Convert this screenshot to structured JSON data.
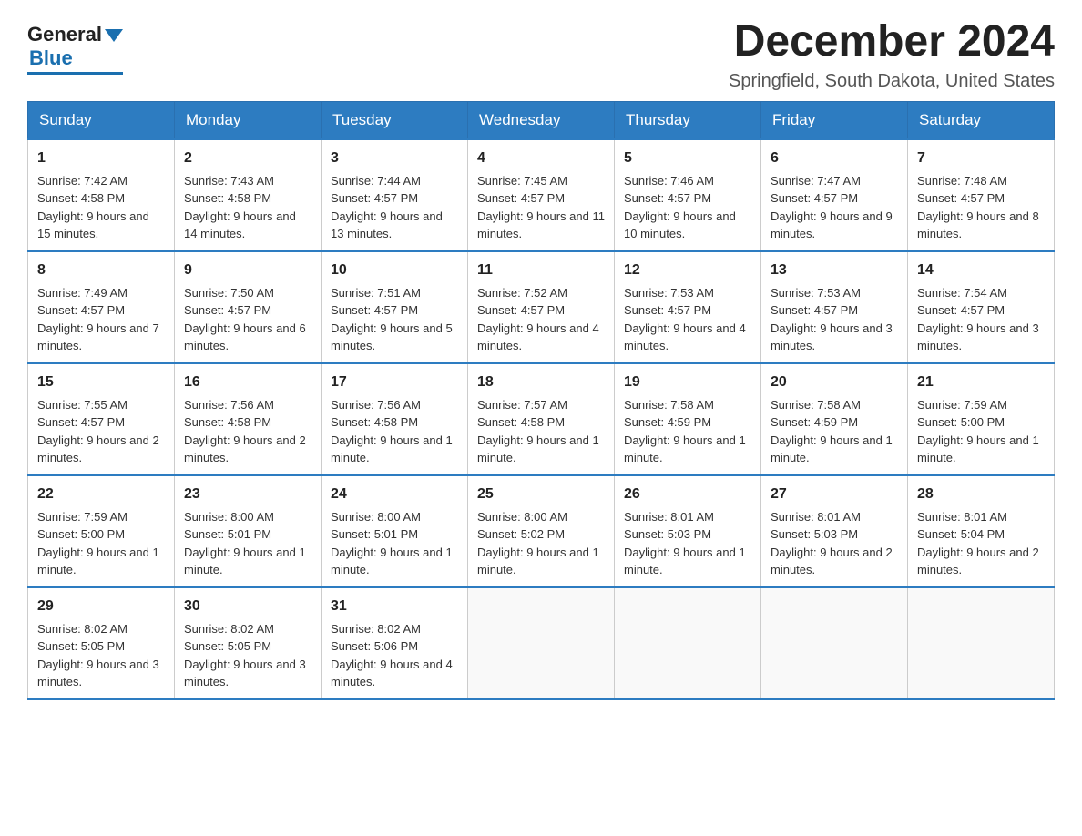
{
  "logo": {
    "general": "General",
    "blue": "Blue"
  },
  "title": "December 2024",
  "location": "Springfield, South Dakota, United States",
  "weekdays": [
    "Sunday",
    "Monday",
    "Tuesday",
    "Wednesday",
    "Thursday",
    "Friday",
    "Saturday"
  ],
  "weeks": [
    [
      {
        "day": "1",
        "sunrise": "7:42 AM",
        "sunset": "4:58 PM",
        "daylight": "9 hours and 15 minutes."
      },
      {
        "day": "2",
        "sunrise": "7:43 AM",
        "sunset": "4:58 PM",
        "daylight": "9 hours and 14 minutes."
      },
      {
        "day": "3",
        "sunrise": "7:44 AM",
        "sunset": "4:57 PM",
        "daylight": "9 hours and 13 minutes."
      },
      {
        "day": "4",
        "sunrise": "7:45 AM",
        "sunset": "4:57 PM",
        "daylight": "9 hours and 11 minutes."
      },
      {
        "day": "5",
        "sunrise": "7:46 AM",
        "sunset": "4:57 PM",
        "daylight": "9 hours and 10 minutes."
      },
      {
        "day": "6",
        "sunrise": "7:47 AM",
        "sunset": "4:57 PM",
        "daylight": "9 hours and 9 minutes."
      },
      {
        "day": "7",
        "sunrise": "7:48 AM",
        "sunset": "4:57 PM",
        "daylight": "9 hours and 8 minutes."
      }
    ],
    [
      {
        "day": "8",
        "sunrise": "7:49 AM",
        "sunset": "4:57 PM",
        "daylight": "9 hours and 7 minutes."
      },
      {
        "day": "9",
        "sunrise": "7:50 AM",
        "sunset": "4:57 PM",
        "daylight": "9 hours and 6 minutes."
      },
      {
        "day": "10",
        "sunrise": "7:51 AM",
        "sunset": "4:57 PM",
        "daylight": "9 hours and 5 minutes."
      },
      {
        "day": "11",
        "sunrise": "7:52 AM",
        "sunset": "4:57 PM",
        "daylight": "9 hours and 4 minutes."
      },
      {
        "day": "12",
        "sunrise": "7:53 AM",
        "sunset": "4:57 PM",
        "daylight": "9 hours and 4 minutes."
      },
      {
        "day": "13",
        "sunrise": "7:53 AM",
        "sunset": "4:57 PM",
        "daylight": "9 hours and 3 minutes."
      },
      {
        "day": "14",
        "sunrise": "7:54 AM",
        "sunset": "4:57 PM",
        "daylight": "9 hours and 3 minutes."
      }
    ],
    [
      {
        "day": "15",
        "sunrise": "7:55 AM",
        "sunset": "4:57 PM",
        "daylight": "9 hours and 2 minutes."
      },
      {
        "day": "16",
        "sunrise": "7:56 AM",
        "sunset": "4:58 PM",
        "daylight": "9 hours and 2 minutes."
      },
      {
        "day": "17",
        "sunrise": "7:56 AM",
        "sunset": "4:58 PM",
        "daylight": "9 hours and 1 minute."
      },
      {
        "day": "18",
        "sunrise": "7:57 AM",
        "sunset": "4:58 PM",
        "daylight": "9 hours and 1 minute."
      },
      {
        "day": "19",
        "sunrise": "7:58 AM",
        "sunset": "4:59 PM",
        "daylight": "9 hours and 1 minute."
      },
      {
        "day": "20",
        "sunrise": "7:58 AM",
        "sunset": "4:59 PM",
        "daylight": "9 hours and 1 minute."
      },
      {
        "day": "21",
        "sunrise": "7:59 AM",
        "sunset": "5:00 PM",
        "daylight": "9 hours and 1 minute."
      }
    ],
    [
      {
        "day": "22",
        "sunrise": "7:59 AM",
        "sunset": "5:00 PM",
        "daylight": "9 hours and 1 minute."
      },
      {
        "day": "23",
        "sunrise": "8:00 AM",
        "sunset": "5:01 PM",
        "daylight": "9 hours and 1 minute."
      },
      {
        "day": "24",
        "sunrise": "8:00 AM",
        "sunset": "5:01 PM",
        "daylight": "9 hours and 1 minute."
      },
      {
        "day": "25",
        "sunrise": "8:00 AM",
        "sunset": "5:02 PM",
        "daylight": "9 hours and 1 minute."
      },
      {
        "day": "26",
        "sunrise": "8:01 AM",
        "sunset": "5:03 PM",
        "daylight": "9 hours and 1 minute."
      },
      {
        "day": "27",
        "sunrise": "8:01 AM",
        "sunset": "5:03 PM",
        "daylight": "9 hours and 2 minutes."
      },
      {
        "day": "28",
        "sunrise": "8:01 AM",
        "sunset": "5:04 PM",
        "daylight": "9 hours and 2 minutes."
      }
    ],
    [
      {
        "day": "29",
        "sunrise": "8:02 AM",
        "sunset": "5:05 PM",
        "daylight": "9 hours and 3 minutes."
      },
      {
        "day": "30",
        "sunrise": "8:02 AM",
        "sunset": "5:05 PM",
        "daylight": "9 hours and 3 minutes."
      },
      {
        "day": "31",
        "sunrise": "8:02 AM",
        "sunset": "5:06 PM",
        "daylight": "9 hours and 4 minutes."
      },
      null,
      null,
      null,
      null
    ]
  ],
  "labels": {
    "sunrise": "Sunrise:",
    "sunset": "Sunset:",
    "daylight": "Daylight:"
  }
}
